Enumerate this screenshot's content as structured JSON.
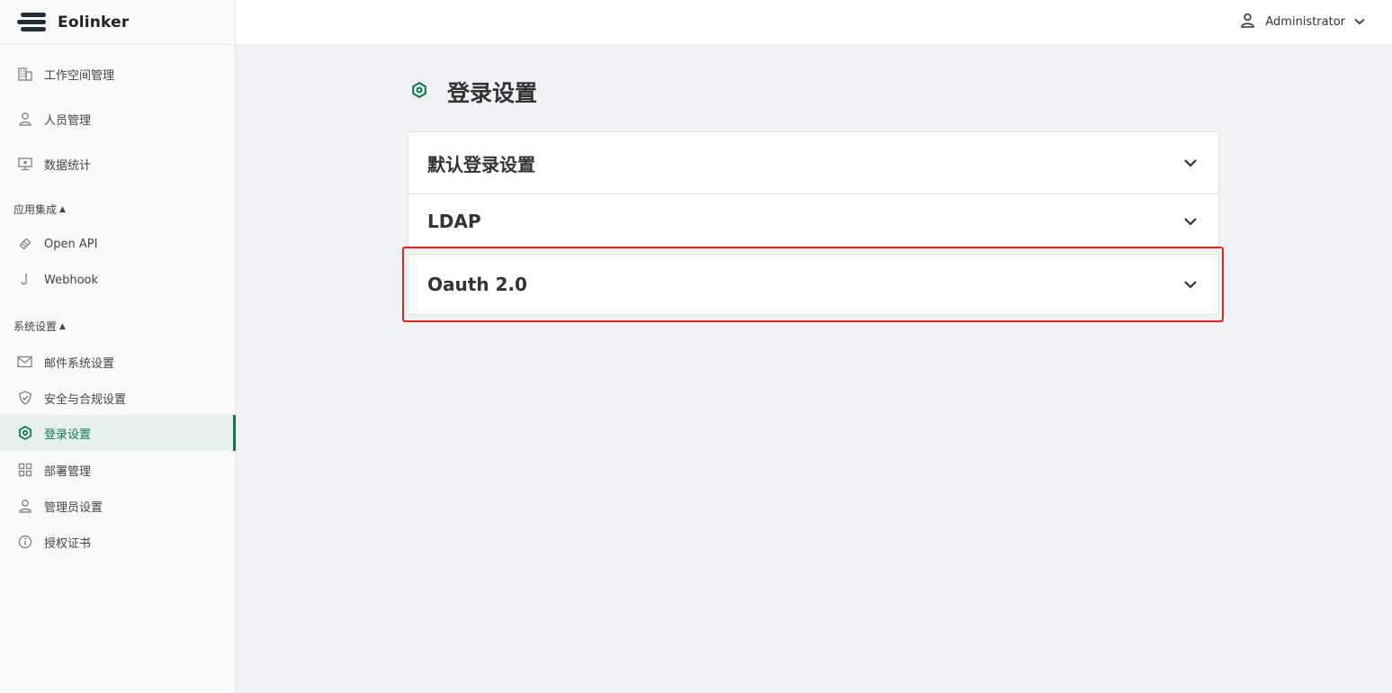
{
  "app": {
    "name": "Eolinker"
  },
  "user": {
    "name": "Administrator"
  },
  "sidebar": {
    "items": [
      {
        "label": "工作空间管理",
        "icon": "building-icon"
      },
      {
        "label": "人员管理",
        "icon": "user-icon"
      },
      {
        "label": "数据统计",
        "icon": "monitor-icon"
      }
    ],
    "groups": [
      {
        "label": "应用集成",
        "items": [
          {
            "label": "Open API",
            "icon": "plug-icon"
          },
          {
            "label": "Webhook",
            "icon": "hook-icon"
          }
        ]
      },
      {
        "label": "系统设置",
        "items": [
          {
            "label": "邮件系统设置",
            "icon": "mail-icon"
          },
          {
            "label": "安全与合规设置",
            "icon": "shield-icon"
          },
          {
            "label": "登录设置",
            "icon": "gear-icon",
            "active": true
          },
          {
            "label": "部署管理",
            "icon": "grid-icon"
          },
          {
            "label": "管理员设置",
            "icon": "admin-icon"
          },
          {
            "label": "授权证书",
            "icon": "info-icon"
          }
        ]
      }
    ]
  },
  "page": {
    "title": "登录设置",
    "sections": [
      {
        "label": "默认登录设置"
      },
      {
        "label": "LDAP"
      },
      {
        "label": "Oauth 2.0"
      }
    ]
  },
  "colors": {
    "accent": "#0f7a52",
    "highlight": "#e1251b"
  }
}
